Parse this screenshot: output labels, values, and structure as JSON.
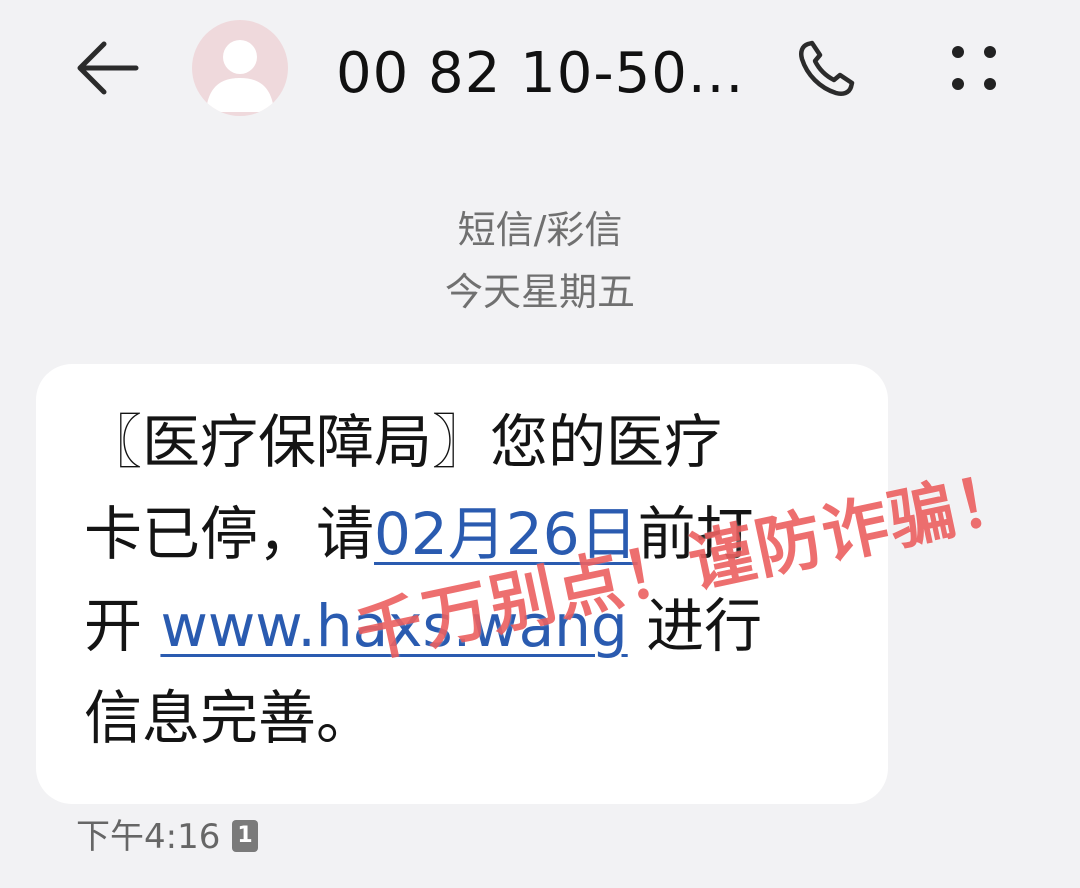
{
  "header": {
    "back_icon": "arrow-left-icon",
    "avatar_icon": "person-icon",
    "contact_number": "00 82 10-50...",
    "call_icon": "phone-icon",
    "more_icon": "more-dots-icon"
  },
  "thread": {
    "message_type": "短信/彩信",
    "date": "今天星期五"
  },
  "message": {
    "line1": "〖医疗保障局〗您的医疗",
    "line2_prefix": "卡已停，请",
    "line2_date_link": "02月26日",
    "line2_suffix": "前打",
    "line3_prefix": "开 ",
    "line3_url": "www.haxs.wang",
    "line3_suffix": " 进行",
    "line4": "信息完善。",
    "time": "下午4:16",
    "sim_slot": "1",
    "link_color": "#2a5bb0"
  },
  "overlay": {
    "warning_stamp": "千万别点！谨防诈骗！",
    "stamp_color": "#e84646"
  }
}
